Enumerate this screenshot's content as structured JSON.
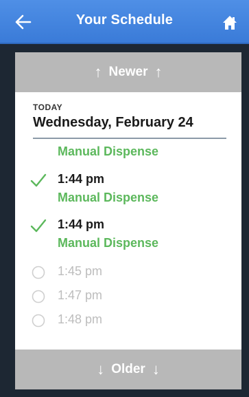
{
  "header": {
    "title": "Your Schedule",
    "back_icon": "back-arrow-icon",
    "home_icon": "home-icon",
    "background": "#4a89e2"
  },
  "nav": {
    "newer_label": "Newer",
    "older_label": "Older"
  },
  "day": {
    "label": "TODAY",
    "date": "Wednesday, February 24"
  },
  "schedule": {
    "partial_top_note": "Manual Dispense",
    "items": [
      {
        "time": "1:44 pm",
        "status": "taken",
        "note": "Manual Dispense"
      },
      {
        "time": "1:44 pm",
        "status": "taken",
        "note": "Manual Dispense"
      },
      {
        "time": "1:45 pm",
        "status": "pending"
      },
      {
        "time": "1:47 pm",
        "status": "pending"
      },
      {
        "time": "1:48 pm",
        "status": "pending"
      }
    ]
  },
  "colors": {
    "taken": "#5cb85c",
    "pending": "#bdbdbd",
    "nav_bar": "#b8b8b8",
    "background": "#1d2733"
  }
}
